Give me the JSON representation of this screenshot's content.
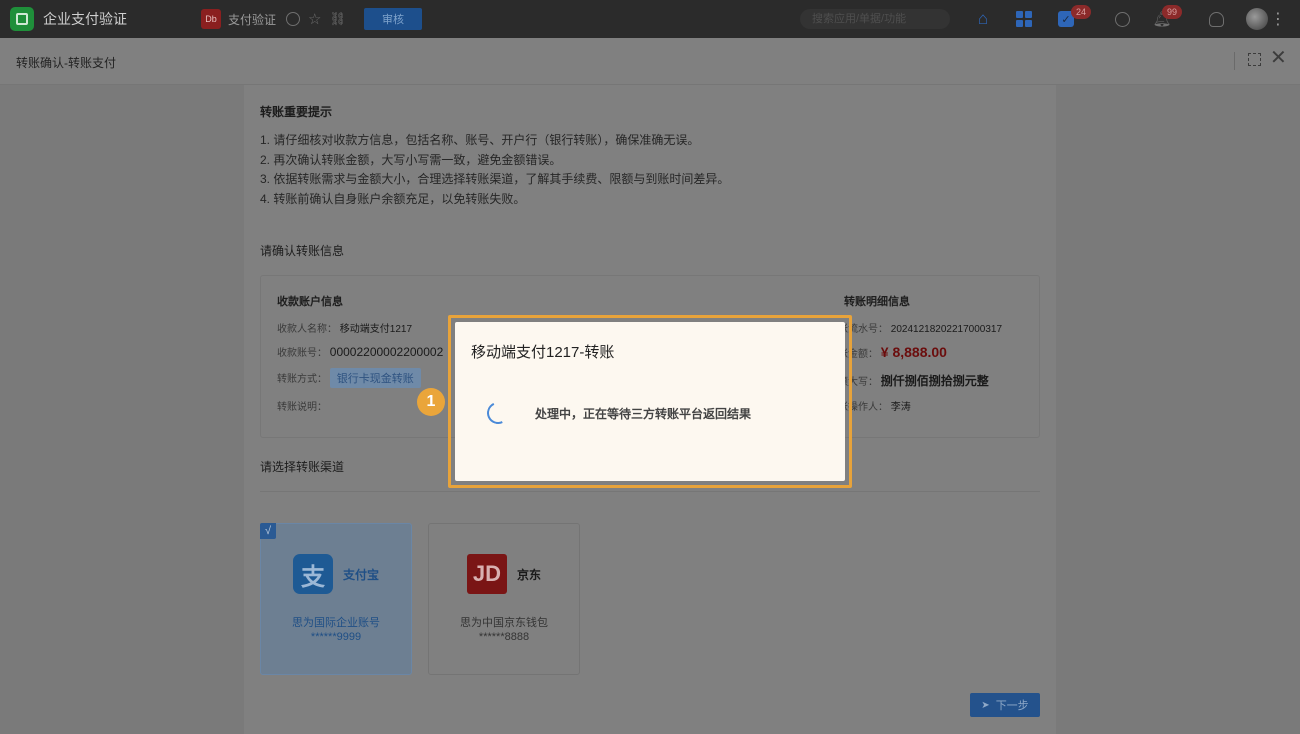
{
  "topbar": {
    "app_title": "企业支付验证",
    "tab_logo_text": "Db",
    "tab_title": "支付验证",
    "action_button": "审核",
    "search_placeholder": "搜索应用/单据/功能",
    "todo_badge": "24",
    "bell_badge": "99"
  },
  "subbar": {
    "breadcrumb": "转账确认-转账支付"
  },
  "tips": {
    "title": "转账重要提示",
    "items": [
      "1. 请仔细核对收款方信息，包括名称、账号、开户行（银行转账），确保准确无误。",
      "2. 再次确认转账金额，大写小写需一致，避免金额错误。",
      "3. 依据转账需求与金额大小，合理选择转账渠道，了解其手续费、限额与到账时间差异。",
      "4. 转账前确认自身账户余额充足，以免转账失败。"
    ]
  },
  "confirm": {
    "section_title": "请确认转账信息",
    "receiver": {
      "title": "收款账户信息",
      "name_label": "收款人名称：",
      "name_value": "移动端支付1217",
      "account_label": "收款账号：",
      "account_value": "00002200002200002",
      "method_label": "转账方式：",
      "method_value": "银行卡现金转账",
      "remark_label": "转账说明："
    },
    "detail": {
      "title": "转账明细信息",
      "serial_label": "转账流水号：",
      "serial_value": "20241218202217000317",
      "amount_label": "转账金额：",
      "amount_value": "¥ 8,888.00",
      "amount_cn_label": "金额大写：",
      "amount_cn_value": "捌仟捌佰捌拾捌元整",
      "operator_label": "转账操作人：",
      "operator_value": "李涛"
    }
  },
  "channels": {
    "section_title": "请选择转账渠道",
    "items": [
      {
        "logo": "支",
        "name": "支付宝",
        "account_name": "思为国际企业账号",
        "account_no": "******9999",
        "selected": true
      },
      {
        "logo": "JD",
        "name": "京东",
        "account_name": "思为中国京东钱包",
        "account_no": "******8888",
        "selected": false
      }
    ],
    "check_mark": "√",
    "next_button": "下一步"
  },
  "dialog": {
    "title": "移动端支付1217-转账",
    "message": "处理中，正在等待三方转账平台返回结果"
  },
  "step_badge": "1"
}
